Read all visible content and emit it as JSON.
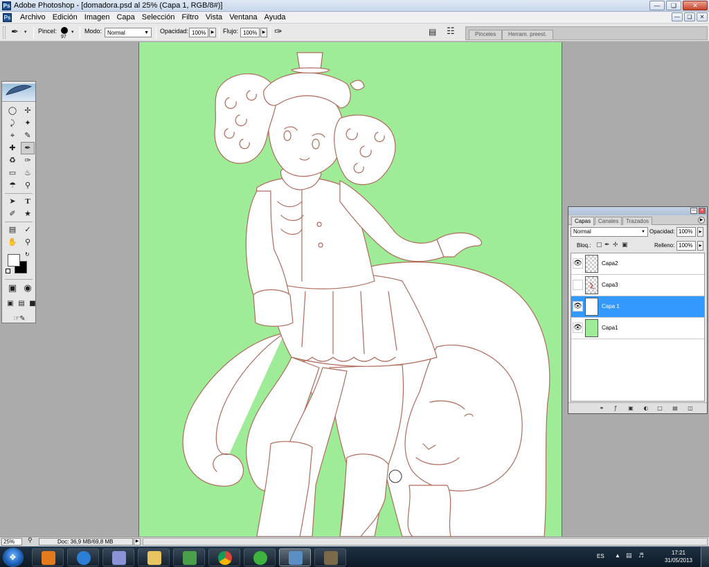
{
  "window": {
    "title": "Adobe Photoshop - [domadora.psd al 25% (Capa 1, RGB/8#)]",
    "app_icon": "photoshop-ps-icon",
    "controls": [
      "minimize",
      "maximize",
      "close"
    ]
  },
  "menu": {
    "items": [
      "Archivo",
      "Edición",
      "Imagen",
      "Capa",
      "Selección",
      "Filtro",
      "Vista",
      "Ventana",
      "Ayuda"
    ]
  },
  "options": {
    "pincel_label": "Pincel:",
    "brush_size": "97",
    "modo_label": "Modo:",
    "modo_value": "Normal",
    "opacidad_label": "Opacidad:",
    "opacidad_value": "100%",
    "flujo_label": "Flujo:",
    "flujo_value": "100%",
    "well_tabs": [
      "Pinceles",
      "Herram. preest."
    ]
  },
  "tools": {
    "icons": [
      "marquee-icon",
      "move-icon",
      "lasso-icon",
      "magic-wand-icon",
      "crop-icon",
      "slice-icon",
      "healing-icon",
      "brush-icon",
      "clone-stamp-icon",
      "history-brush-icon",
      "eraser-icon",
      "paint-bucket-icon",
      "blur-icon",
      "dodge-icon",
      "path-select-icon",
      "type-icon",
      "pen-icon",
      "shape-icon",
      "notes-icon",
      "eyedropper-icon",
      "hand-icon",
      "zoom-icon"
    ],
    "active": "brush-icon",
    "foreground_color": "#ffffff",
    "background_color": "#000000"
  },
  "canvas": {
    "background_color": "#9eec97",
    "line_color": "#b06a5a",
    "cursor": "brush-circle-cursor"
  },
  "layers_panel": {
    "tabs": [
      "Capas",
      "Canales",
      "Trazados"
    ],
    "active_tab": "Capas",
    "blend_mode": "Normal",
    "opacidad_label": "Opacidad:",
    "opacidad_value": "100%",
    "bloq_label": "Bloq.:",
    "relleno_label": "Relleno:",
    "relleno_value": "100%",
    "layers": [
      {
        "name": "Capa2",
        "visible": true,
        "selected": false,
        "thumb": "transparent"
      },
      {
        "name": "Capa3",
        "visible": false,
        "selected": false,
        "thumb": "transparent-sketch"
      },
      {
        "name": "Capa 1",
        "visible": true,
        "selected": true,
        "thumb": "white"
      },
      {
        "name": "Capa1",
        "visible": true,
        "selected": false,
        "thumb": "green"
      }
    ],
    "footer_icons": [
      "link-icon",
      "layer-style-icon",
      "layer-mask-icon",
      "adjustment-layer-icon",
      "folder-icon",
      "new-layer-icon",
      "trash-icon"
    ]
  },
  "status": {
    "zoom": "25%",
    "doc_info": "Doc: 36,9 MB/69,8 MB"
  },
  "taskbar": {
    "apps": [
      "media-player-icon",
      "internet-explorer-icon",
      "network-app-icon",
      "explorer-folder-icon",
      "users-app-icon",
      "chrome-icon",
      "app-green-icon",
      "photoshop-feather-icon",
      "app-pen-icon"
    ],
    "active_app": "photoshop-feather-icon",
    "language": "ES",
    "time": "17:21",
    "date": "31/05/2013"
  }
}
